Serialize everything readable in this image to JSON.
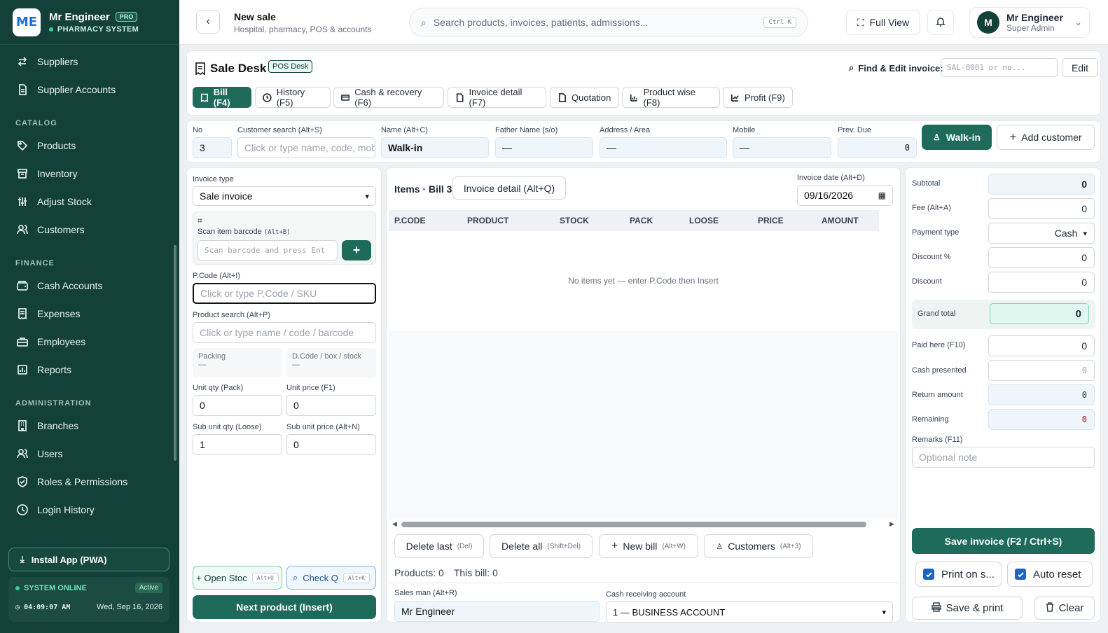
{
  "brand": {
    "name": "Mr Engineer",
    "badge": "PRO",
    "sub": "PHARMACY SYSTEM",
    "logo": "ME"
  },
  "nav": {
    "items_top": [
      {
        "label": "Suppliers",
        "icon": "arrows-icon"
      },
      {
        "label": "Supplier Accounts",
        "icon": "file-icon"
      }
    ],
    "catalog_title": "CATALOG",
    "catalog": [
      {
        "label": "Products",
        "icon": "tag-icon"
      },
      {
        "label": "Inventory",
        "icon": "archive-icon"
      },
      {
        "label": "Adjust Stock",
        "icon": "sliders-icon"
      },
      {
        "label": "Customers",
        "icon": "users-icon"
      }
    ],
    "finance_title": "FINANCE",
    "finance": [
      {
        "label": "Cash Accounts",
        "icon": "wallet-icon"
      },
      {
        "label": "Expenses",
        "icon": "receipt-icon"
      },
      {
        "label": "Employees",
        "icon": "briefcase-icon"
      },
      {
        "label": "Reports",
        "icon": "chart-icon"
      }
    ],
    "admin_title": "ADMINISTRATION",
    "admin": [
      {
        "label": "Branches",
        "icon": "building-icon"
      },
      {
        "label": "Users",
        "icon": "users-icon"
      },
      {
        "label": "Roles & Permissions",
        "icon": "shield-icon"
      },
      {
        "label": "Login History",
        "icon": "clock-icon"
      }
    ]
  },
  "install": "Install App (PWA)",
  "status": {
    "online": "SYSTEM ONLINE",
    "active": "Active",
    "time": "04:09:07 AM",
    "date": "Wed, Sep 16, 2026"
  },
  "topbar": {
    "title": "New sale",
    "subtitle": "Hospital, pharmacy, POS & accounts",
    "search_placeholder": "Search products, invoices, patients, admissions...",
    "search_kbd": "Ctrl K",
    "full_view": "Full View",
    "user_name": "Mr Engineer",
    "user_role": "Super Admin",
    "avatar": "M"
  },
  "desk": {
    "title": "Sale Desk",
    "badge": "POS Desk",
    "find_label": "Find & Edit invoice:",
    "find_placeholder": "SAL-0001 or no...",
    "edit": "Edit"
  },
  "tabs": [
    "Bill (F4)",
    "History (F5)",
    "Cash & recovery (F6)",
    "Invoice detail (F7)",
    "Quotation",
    "Product wise (F8)",
    "Profit (F9)"
  ],
  "customer": {
    "no_label": "No",
    "no": "3",
    "search_label": "Customer search (Alt+S)",
    "search_placeholder": "Click or type name, code, mob",
    "name_label": "Name (Alt+C)",
    "name": "Walk-in",
    "father_label": "Father Name (s/o)",
    "father": "—",
    "address_label": "Address / Area",
    "address": "—",
    "mobile_label": "Mobile",
    "mobile": "—",
    "due_label": "Prev. Due",
    "due": "0",
    "walkin": "Walk-in",
    "add": "Add customer"
  },
  "left": {
    "type_label": "Invoice type",
    "type": "Sale invoice",
    "scan_label": "Scan item barcode",
    "scan_kbd": "(Alt+B)",
    "scan_placeholder": "Scan barcode and press Ent",
    "pcode_label": "P.Code (Alt+I)",
    "pcode_placeholder": "Click or type P.Code / SKU",
    "psearch_label": "Product search (Alt+P)",
    "psearch_placeholder": "Click or type name / code / barcode",
    "packing_label": "Packing",
    "packing": "—",
    "dcode_label": "D.Code / box / stock",
    "dcode": "—",
    "uqty_label": "Unit qty (Pack)",
    "uqty": "0",
    "uprice_label": "Unit price (F1)",
    "uprice": "0",
    "sqty_label": "Sub unit qty (Loose)",
    "sqty": "1",
    "sprice_label": "Sub unit price (Alt+N)",
    "sprice": "0",
    "open_stock": "+ Open Stoc",
    "open_kbd": "Alt+O",
    "check": "Check Q",
    "check_kbd": "Alt+K",
    "next": "Next product (Insert)"
  },
  "items": {
    "title": "Items · Bill 3",
    "detail_btn": "Invoice detail (Alt+Q)",
    "date_label": "Invoice date (Alt+D)",
    "date": "09/16/2026",
    "columns": [
      "P.CODE",
      "PRODUCT",
      "STOCK",
      "PACK",
      "LOOSE",
      "PRICE",
      "AMOUNT"
    ],
    "empty": "No items yet — enter P.Code then Insert",
    "delete_last": "Delete last",
    "delete_last_k": "(Del)",
    "delete_all": "Delete all",
    "delete_all_k": "(Shift+Del)",
    "new_bill": "New bill",
    "new_bill_k": "(Alt+W)",
    "customers": "Customers",
    "customers_k": "(Alt+3)",
    "products_count": "Products: 0",
    "this_bill": "This bill: 0",
    "salesman_label": "Sales man (Alt+R)",
    "salesman": "Mr Engineer",
    "account_label": "Cash receiving account",
    "account": "1 — BUSINESS ACCOUNT"
  },
  "totals": {
    "subtotal_label": "Subtotal",
    "subtotal": "0",
    "fee_label": "Fee (Alt+A)",
    "fee": "0",
    "payment_label": "Payment type",
    "payment": "Cash",
    "discpct_label": "Discount %",
    "discpct": "0",
    "disc_label": "Discount",
    "disc": "0",
    "grand_label": "Grand total",
    "grand": "0",
    "paid_label": "Paid here (F10)",
    "paid": "0",
    "cash_label": "Cash presented",
    "cash": "0",
    "return_label": "Return amount",
    "return": "0",
    "remaining_label": "Remaining",
    "remaining": "0",
    "remarks_label": "Remarks (F11)",
    "remarks_placeholder": "Optional note",
    "save": "Save invoice (F2 / Ctrl+S)",
    "print_on": "Print on s...",
    "auto_reset": "Auto reset",
    "save_print": "Save & print",
    "clear": "Clear"
  }
}
